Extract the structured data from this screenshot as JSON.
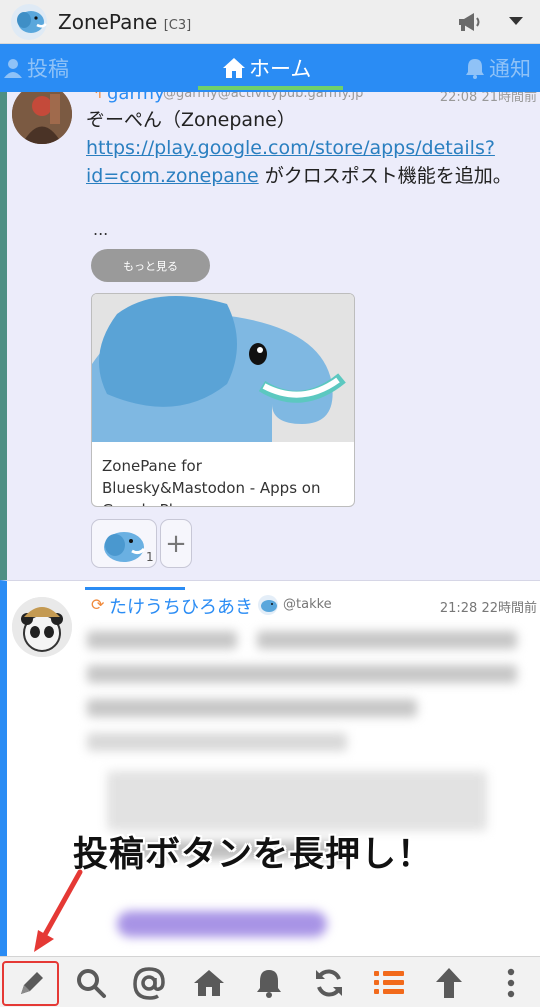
{
  "app": {
    "title": "ZonePane",
    "account_tag": "[C3]"
  },
  "tabs": [
    {
      "label": "投稿"
    },
    {
      "label": "ホーム"
    },
    {
      "label": "通知"
    }
  ],
  "posts": [
    {
      "name": "garmy",
      "acct": "@garmy@activitypub.garmy.jp",
      "time": "22:08 21時間前",
      "body_pre": "ぞーぺん（Zonepane） ",
      "body_link": "https://play.google.com/store/apps/details?id=com.zonepane",
      "body_post": " がクロスポスト機能を追加。",
      "ellipsis": "...",
      "more_label": "もっと見る",
      "card_title": "ZonePane for Bluesky&Mastodon - Apps on Google Play",
      "reaction_count": "1",
      "add_reaction": "+"
    },
    {
      "name": "たけうちひろあき",
      "acct": "@takke",
      "time": "21:28 22時間前"
    }
  ],
  "overlay": {
    "caption": "投稿ボタンを長押し！"
  },
  "bottom_bar": {
    "icons": [
      "compose-icon",
      "search-icon",
      "mention-icon",
      "home-icon",
      "notification-icon",
      "refresh-icon",
      "list-icon",
      "scroll-top-icon",
      "more-icon"
    ]
  },
  "colors": {
    "accent": "#2a8cf4",
    "tab_indicator": "#6fd06a",
    "highlight_red": "#e53935",
    "list_orange": "#f26a1b"
  }
}
